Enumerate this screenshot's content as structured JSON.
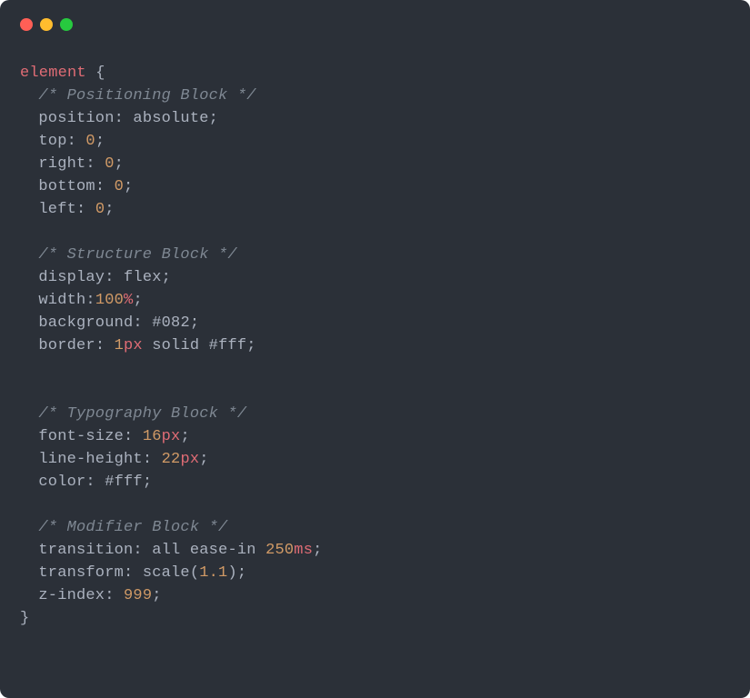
{
  "window": {
    "traffic_lights": {
      "close": "red",
      "minimize": "yellow",
      "zoom": "green"
    }
  },
  "code": {
    "selector": "element",
    "open_brace": "{",
    "close_brace": "}",
    "blocks": [
      {
        "comment": "/* Positioning Block */",
        "decls": [
          {
            "prop": "position",
            "tokens": [
              {
                "t": "val",
                "v": "absolute"
              }
            ]
          },
          {
            "prop": "top",
            "tokens": [
              {
                "t": "num",
                "v": "0"
              }
            ]
          },
          {
            "prop": "right",
            "tokens": [
              {
                "t": "num",
                "v": "0"
              }
            ]
          },
          {
            "prop": "bottom",
            "tokens": [
              {
                "t": "num",
                "v": "0"
              }
            ]
          },
          {
            "prop": "left",
            "tokens": [
              {
                "t": "num",
                "v": "0"
              }
            ]
          }
        ]
      },
      {
        "comment": "/* Structure Block */",
        "decls": [
          {
            "prop": "display",
            "tokens": [
              {
                "t": "val",
                "v": "flex"
              }
            ]
          },
          {
            "prop": "width",
            "no_space": true,
            "tokens": [
              {
                "t": "num",
                "v": "100"
              },
              {
                "t": "unit",
                "v": "%"
              }
            ]
          },
          {
            "prop": "background",
            "tokens": [
              {
                "t": "hex",
                "v": "#082"
              }
            ]
          },
          {
            "prop": "border",
            "tokens": [
              {
                "t": "num",
                "v": "1"
              },
              {
                "t": "unit",
                "v": "px"
              },
              {
                "t": "sp"
              },
              {
                "t": "val",
                "v": "solid"
              },
              {
                "t": "sp"
              },
              {
                "t": "hex",
                "v": "#fff"
              }
            ]
          }
        ],
        "trailing_blank": 1
      },
      {
        "comment": "/* Typography Block */",
        "decls": [
          {
            "prop": "font-size",
            "tokens": [
              {
                "t": "num",
                "v": "16"
              },
              {
                "t": "unit",
                "v": "px"
              }
            ]
          },
          {
            "prop": "line-height",
            "tokens": [
              {
                "t": "num",
                "v": "22"
              },
              {
                "t": "unit",
                "v": "px"
              }
            ]
          },
          {
            "prop": "color",
            "tokens": [
              {
                "t": "hex",
                "v": "#fff"
              }
            ]
          }
        ]
      },
      {
        "comment": "/* Modifier Block */",
        "decls": [
          {
            "prop": "transition",
            "tokens": [
              {
                "t": "val",
                "v": "all"
              },
              {
                "t": "sp"
              },
              {
                "t": "val",
                "v": "ease-in"
              },
              {
                "t": "sp"
              },
              {
                "t": "num",
                "v": "250"
              },
              {
                "t": "unit",
                "v": "ms"
              }
            ]
          },
          {
            "prop": "transform",
            "tokens": [
              {
                "t": "val",
                "v": "scale"
              },
              {
                "t": "punct",
                "v": "("
              },
              {
                "t": "num",
                "v": "1.1"
              },
              {
                "t": "punct",
                "v": ")"
              }
            ]
          },
          {
            "prop": "z-index",
            "tokens": [
              {
                "t": "num",
                "v": "999"
              }
            ]
          }
        ]
      }
    ]
  }
}
